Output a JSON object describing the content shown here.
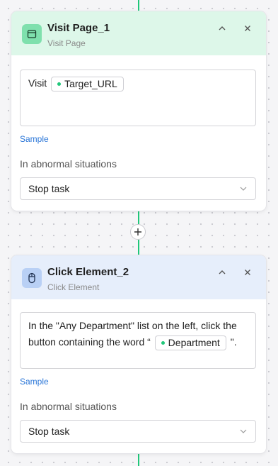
{
  "nodes": [
    {
      "title": "Visit Page_1",
      "subtitle": "Visit Page",
      "icon": "browser-window-icon",
      "header_color": "#ddf7e9",
      "icon_bg": "#7fe0ad",
      "content_prefix": "Visit",
      "token": "Target_URL",
      "sample_label": "Sample",
      "abnormal_label": "In abnormal situations",
      "abnormal_value": "Stop task"
    },
    {
      "title": "Click Element_2",
      "subtitle": "Click Element",
      "icon": "mouse-icon",
      "header_color": "#e6eefb",
      "icon_bg": "#b9d0f5",
      "content_prefix": "In the \"Any Department\" list on the left, click the button containing the word “",
      "token": "Department",
      "content_suffix": "\".",
      "sample_label": "Sample",
      "abnormal_label": "In abnormal situations",
      "abnormal_value": "Stop task"
    }
  ],
  "colors": {
    "connector": "#20c77a",
    "link": "#2a76d8"
  }
}
